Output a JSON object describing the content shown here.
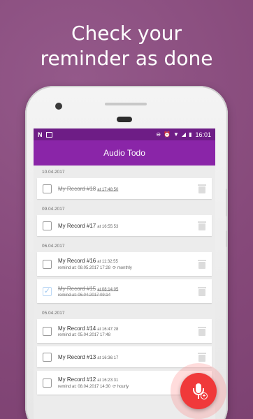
{
  "headline": [
    "Check your",
    "reminder as done"
  ],
  "statusbar": {
    "time": "16:01",
    "left_icon": "N"
  },
  "app": {
    "title": "Audio Todo"
  },
  "groups": [
    {
      "date": "10.04.2017",
      "items": [
        {
          "title": "My Record #18",
          "at_time": "at 17:48:50",
          "remind": "",
          "repeat": "",
          "checked": false,
          "done": true
        }
      ]
    },
    {
      "date": "09.04.2017",
      "items": [
        {
          "title": "My Record #17",
          "at_time": "at 16:55:53",
          "remind": "",
          "repeat": "",
          "checked": false,
          "done": false
        }
      ]
    },
    {
      "date": "06.04.2017",
      "items": [
        {
          "title": "My Record #16",
          "at_time": "at 11:32:55",
          "remind": "remind at: 08.05.2017 17:28",
          "repeat": "monthly",
          "checked": false,
          "done": false
        },
        {
          "title": "My Record #15",
          "at_time": "at 08:14:05",
          "remind": "remind at: 06.04.2017 09:14",
          "repeat": "",
          "checked": true,
          "done": true
        }
      ]
    },
    {
      "date": "05.04.2017",
      "items": [
        {
          "title": "My Record #14",
          "at_time": "at 16:47:28",
          "remind": "remind at: 05.04.2017 17:48",
          "repeat": "",
          "checked": false,
          "done": false
        },
        {
          "title": "My Record #13",
          "at_time": "at 16:36:17",
          "remind": "",
          "repeat": "",
          "checked": false,
          "done": false
        },
        {
          "title": "My Record #12",
          "at_time": "at 16:23:31",
          "remind": "remind at: 08.04.2017 14:30",
          "repeat": "hourly",
          "checked": false,
          "done": false
        }
      ]
    }
  ],
  "colors": {
    "statusbar": "#6e1d86",
    "appbar": "#8a25a8",
    "fab": "#f0393a",
    "background": "#8a4f7f"
  },
  "icons": {
    "checkbox": "checkbox-icon",
    "trash": "trash-icon",
    "fab": "microphone-add-icon",
    "repeat": "repeat-icon"
  }
}
